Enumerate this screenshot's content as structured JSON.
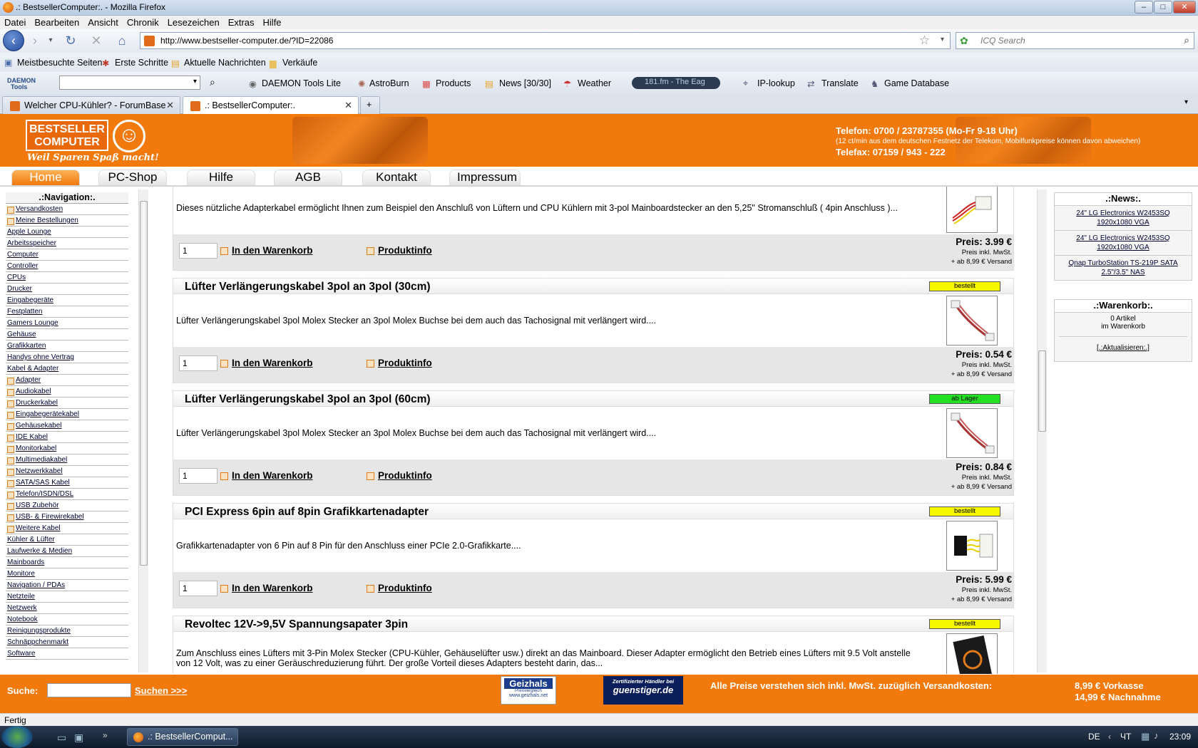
{
  "window": {
    "title": ".: BestsellerComputer:. - Mozilla Firefox"
  },
  "menubar": [
    "Datei",
    "Bearbeiten",
    "Ansicht",
    "Chronik",
    "Lesezeichen",
    "Extras",
    "Hilfe"
  ],
  "url": "http://www.bestseller-computer.de/?ID=22086",
  "search": {
    "placeholder": "ICQ Search"
  },
  "bookmarks": [
    "Meistbesuchte Seiten",
    "Erste Schritte",
    "Aktuelle Nachrichten",
    "Verkäufe"
  ],
  "toolbar": {
    "daemon": "DAEMON Tools Lite",
    "astroburn": "AstroBurn",
    "products": "Products",
    "news": "News [30/30]",
    "weather": "Weather",
    "radio": "181.fm - The Eag",
    "iplookup": "IP-lookup",
    "translate": "Translate",
    "gamedb": "Game Database"
  },
  "tabs": [
    {
      "label": "Welcher CPU-Kühler? - ForumBase"
    },
    {
      "label": ".: BestsellerComputer:."
    }
  ],
  "header": {
    "logo_line1": "BESTSELLER",
    "logo_line2": "COMPUTER",
    "slogan": "Weil Sparen Spaß macht!",
    "phone": "Telefon: 0700 / 23787355 (Mo-Fr 9-18 Uhr)",
    "phone_note": "(12 ct/min aus dem deutschen Festnetz der Telekom, Mobilfunkpreise können davon abweichen)",
    "fax": "Telefax: 07159 / 943 - 222"
  },
  "menu": [
    "Home",
    "PC-Shop",
    "Hilfe",
    "AGB",
    "Kontakt",
    "Impressum"
  ],
  "nav": {
    "title": ".:Navigation:.",
    "items": [
      {
        "label": "Versandkosten",
        "sub": true
      },
      {
        "label": "Meine Bestellungen",
        "sub": true
      },
      {
        "label": "Apple Lounge",
        "sub": false
      },
      {
        "label": "Arbeitsspeicher",
        "sub": false
      },
      {
        "label": "Computer",
        "sub": false
      },
      {
        "label": "Controller",
        "sub": false
      },
      {
        "label": "CPUs",
        "sub": false
      },
      {
        "label": "Drucker",
        "sub": false
      },
      {
        "label": "Eingabegeräte",
        "sub": false
      },
      {
        "label": "Festplatten",
        "sub": false
      },
      {
        "label": "Gamers Lounge",
        "sub": false
      },
      {
        "label": "Gehäuse",
        "sub": false
      },
      {
        "label": "Grafikkarten",
        "sub": false
      },
      {
        "label": "Handys ohne Vertrag",
        "sub": false
      },
      {
        "label": "Kabel & Adapter",
        "sub": false
      },
      {
        "label": "Adapter",
        "sub": true
      },
      {
        "label": "Audiokabel",
        "sub": true
      },
      {
        "label": "Druckerkabel",
        "sub": true
      },
      {
        "label": "Eingabegerätekabel",
        "sub": true
      },
      {
        "label": "Gehäusekabel",
        "sub": true
      },
      {
        "label": "IDE Kabel",
        "sub": true
      },
      {
        "label": "Monitorkabel",
        "sub": true
      },
      {
        "label": "Multimediakabel",
        "sub": true
      },
      {
        "label": "Netzwerkkabel",
        "sub": true
      },
      {
        "label": "SATA/SAS Kabel",
        "sub": true
      },
      {
        "label": "Telefon/ISDN/DSL",
        "sub": true
      },
      {
        "label": "USB Zubehör",
        "sub": true
      },
      {
        "label": "USB- & Firewirekabel",
        "sub": true
      },
      {
        "label": "Weitere Kabel",
        "sub": true
      },
      {
        "label": "Kühler & Lüfter",
        "sub": false
      },
      {
        "label": "Laufwerke & Medien",
        "sub": false
      },
      {
        "label": "Mainboards",
        "sub": false
      },
      {
        "label": "Monitore",
        "sub": false
      },
      {
        "label": "Navigation / PDAs",
        "sub": false
      },
      {
        "label": "Netzteile",
        "sub": false
      },
      {
        "label": "Netzwerk",
        "sub": false
      },
      {
        "label": "Notebook",
        "sub": false
      },
      {
        "label": "Reinigungsprodukte",
        "sub": false
      },
      {
        "label": "Schnäppchenmarkt",
        "sub": false
      },
      {
        "label": "Software",
        "sub": false
      }
    ]
  },
  "common": {
    "cart": "In den Warenkorb",
    "info": "Produktinfo",
    "qty": "1",
    "mwst": "Preis inkl. MwSt.",
    "ship": "+ ab 8,99 € Versand"
  },
  "products": [
    {
      "title": "",
      "desc": "Dieses nützliche Adapterkabel ermöglicht Ihnen zum Beispiel den Anschluß von Lüftern und CPU Kühlern mit 3-pol Mainboardstecker an den 5,25\" Stromanschluß ( 4pin Anschluss )...",
      "price": "Preis: 3.99 €",
      "badge": "",
      "badge_color": ""
    },
    {
      "title": "Lüfter Verlängerungskabel 3pol an 3pol (30cm)",
      "desc": "Lüfter Verlängerungskabel 3pol Molex Stecker an 3pol Molex Buchse bei dem auch das Tachosignal mit verlängert wird....",
      "price": "Preis: 0.54 €",
      "badge": "bestellt",
      "badge_color": "#f7f700"
    },
    {
      "title": "Lüfter Verlängerungskabel 3pol an 3pol (60cm)",
      "desc": "Lüfter Verlängerungskabel 3pol Molex Stecker an 3pol Molex Buchse bei dem auch das Tachosignal mit verlängert wird....",
      "price": "Preis: 0.84 €",
      "badge": "ab Lager",
      "badge_color": "#22e022"
    },
    {
      "title": "PCI Express 6pin auf 8pin Grafikkartenadapter",
      "desc": "Grafikkartenadapter von 6 Pin auf 8 Pin für den Anschluss einer PCIe 2.0-Grafikkarte....",
      "price": "Preis: 5.99 €",
      "badge": "bestellt",
      "badge_color": "#f7f700"
    },
    {
      "title": "Revoltec 12V->9,5V Spannungsapater 3pin",
      "desc": "Zum Anschluss eines Lüfters mit 3-Pin Molex Stecker (CPU-Kühler, Gehäuselüfter usw.) direkt an das Mainboard. Dieser Adapter ermöglicht den Betrieb eines Lüfters mit 9.5 Volt anstelle von 12 Volt, was zu einer Geräuschreduzierung führt. Der große Vorteil dieses Adapters besteht darin, das...",
      "price": "",
      "badge": "bestellt",
      "badge_color": "#f7f700"
    }
  ],
  "news": {
    "title": ".:News:.",
    "items": [
      "24\" LG Electronics W2453SQ 1920x1080 VGA",
      "24\" LG Electronics W2453SQ 1920x1080 VGA",
      "Qnap TurboStation TS-219P SATA 2.5\"/3.5\" NAS"
    ]
  },
  "cart": {
    "title": ".:Warenkorb:.",
    "line1": "0 Artikel",
    "line2": "im Warenkorb",
    "refresh": "[.:Aktualisieren:.]"
  },
  "footer": {
    "search_label": "Suche:",
    "search_button": "Suchen >>>",
    "badge1": "Geizhals",
    "badge1_sub": "Preisvergleich",
    "badge1_url": "www.geizhals.net",
    "badge2_line1": "Zertifizierter Händler bei",
    "badge2_line2": "guenstiger.de",
    "notice": "Alle Preise verstehen sich inkl. MwSt. zuzüglich Versandkosten:",
    "cost1": "8,99 € Vorkasse",
    "cost2": "14,99 € Nachnahme"
  },
  "status": "Fertig",
  "taskbar": {
    "task": ".: BestsellerComput...",
    "lang": "DE",
    "day": "ЧТ",
    "time": "23:09"
  }
}
